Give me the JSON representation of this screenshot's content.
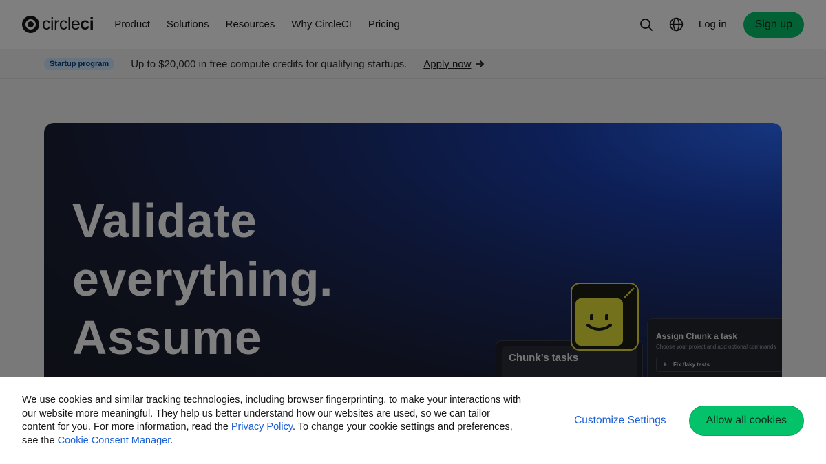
{
  "header": {
    "logo_text_light": "circle",
    "logo_text_bold": "ci",
    "nav": [
      "Product",
      "Solutions",
      "Resources",
      "Why CircleCI",
      "Pricing"
    ],
    "login": "Log in",
    "signup": "Sign up"
  },
  "banner": {
    "badge": "Startup program",
    "text": "Up to $20,000 in free compute credits for qualifying startups.",
    "link": "Apply now"
  },
  "hero": {
    "title_lines": [
      "Validate",
      "everything.",
      "Assume"
    ],
    "tasks_title": "Chunk’s tasks",
    "assign_title": "Assign Chunk a task",
    "assign_sub": "Choose your project and add optional commands",
    "assign_item": "Fix flaky tests"
  },
  "cookie": {
    "text_before": "We use cookies and similar tracking technologies, including browser fingerprinting, to make your interactions with our website more meaningful. They help us better understand how our websites are used, so we can tailor content for you. For more information, read the ",
    "privacy_link": "Privacy Policy",
    "text_middle": ". To change your cookie settings and preferences, see the ",
    "consent_link": "Cookie Consent Manager",
    "text_after": ".",
    "customize": "Customize Settings",
    "allow": "Allow all cookies"
  },
  "colors": {
    "brand_green": "#04c26a",
    "link_blue": "#1a5fd6",
    "hero_dark": "#1a1d29",
    "hero_blue": "#2d6cff",
    "chunk_yellow": "#e8e23a"
  }
}
